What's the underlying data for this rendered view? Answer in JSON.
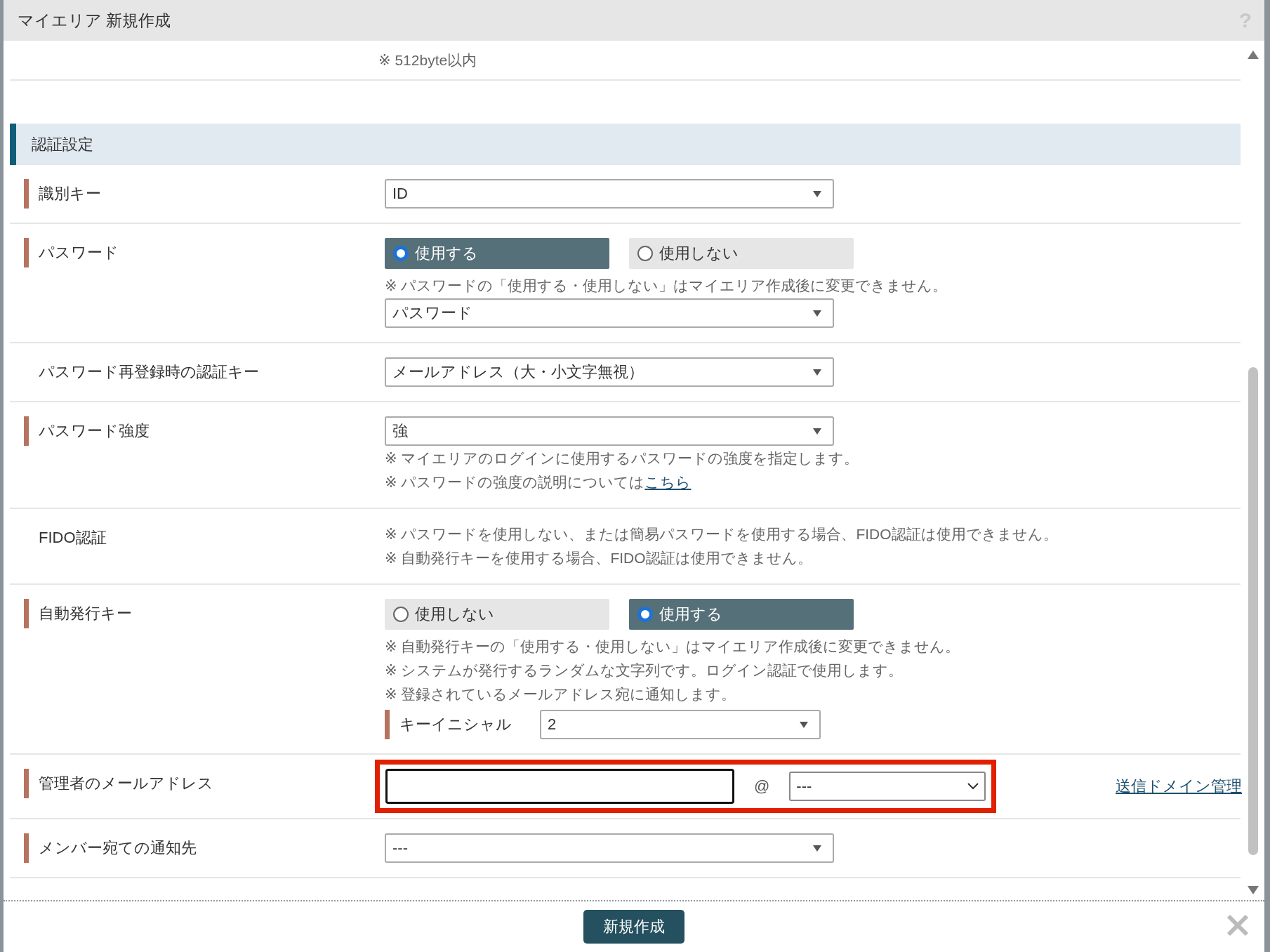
{
  "window": {
    "title": "マイエリア 新規作成",
    "help": "?"
  },
  "top_note": "※ 512byte以内",
  "section": {
    "title": "認証設定"
  },
  "rows": [
    {
      "kind": "select",
      "label": "識別キー",
      "required": true,
      "value": "ID"
    },
    {
      "kind": "radio",
      "label": "パスワード",
      "required": true,
      "options": [
        {
          "label": "使用する",
          "selected": true
        },
        {
          "label": "使用しない",
          "selected": false
        }
      ],
      "notes": [
        {
          "text": "※ パスワードの「使用する・使用しない」はマイエリア作成後に変更できません。"
        }
      ],
      "value": "パスワード"
    },
    {
      "kind": "select",
      "label": "パスワード再登録時の認証キー",
      "required": false,
      "value": "メールアドレス（大・小文字無視）"
    },
    {
      "kind": "select",
      "label": "パスワード強度",
      "required": true,
      "value": "強",
      "notes": [
        {
          "text": "※ マイエリアのログインに使用するパスワードの強度を指定します。"
        },
        {
          "text": "※ パスワードの強度の説明については",
          "link": "こちら"
        }
      ]
    },
    {
      "kind": "notes",
      "label": "FIDO認証",
      "required": false,
      "notes": [
        {
          "text": "※ パスワードを使用しない、または簡易パスワードを使用する場合、FIDO認証は使用できません。"
        },
        {
          "text": "※ 自動発行キーを使用する場合、FIDO認証は使用できません。"
        }
      ]
    },
    {
      "kind": "radio",
      "label": "自動発行キー",
      "required": true,
      "options": [
        {
          "label": "使用しない",
          "selected": false
        },
        {
          "label": "使用する",
          "selected": true
        }
      ],
      "notes": [
        {
          "text": "※ 自動発行キーの「使用する・使用しない」はマイエリア作成後に変更できません。"
        },
        {
          "text": "※ システムが発行するランダムな文字列です。ログイン認証で使用します。"
        },
        {
          "text": "※ 登録されているメールアドレス宛に通知します。"
        }
      ],
      "sub_field": {
        "label": "キーイニシャル",
        "required": true,
        "value": "2"
      }
    },
    {
      "kind": "email",
      "label": "管理者のメールアドレス",
      "required": true,
      "highlighted": true,
      "at": "@",
      "domain": "---",
      "link": "送信ドメイン管理"
    },
    {
      "kind": "select",
      "label": "メンバー宛ての通知先",
      "required": true,
      "value": "---"
    }
  ],
  "footer": {
    "button": "新規作成"
  }
}
